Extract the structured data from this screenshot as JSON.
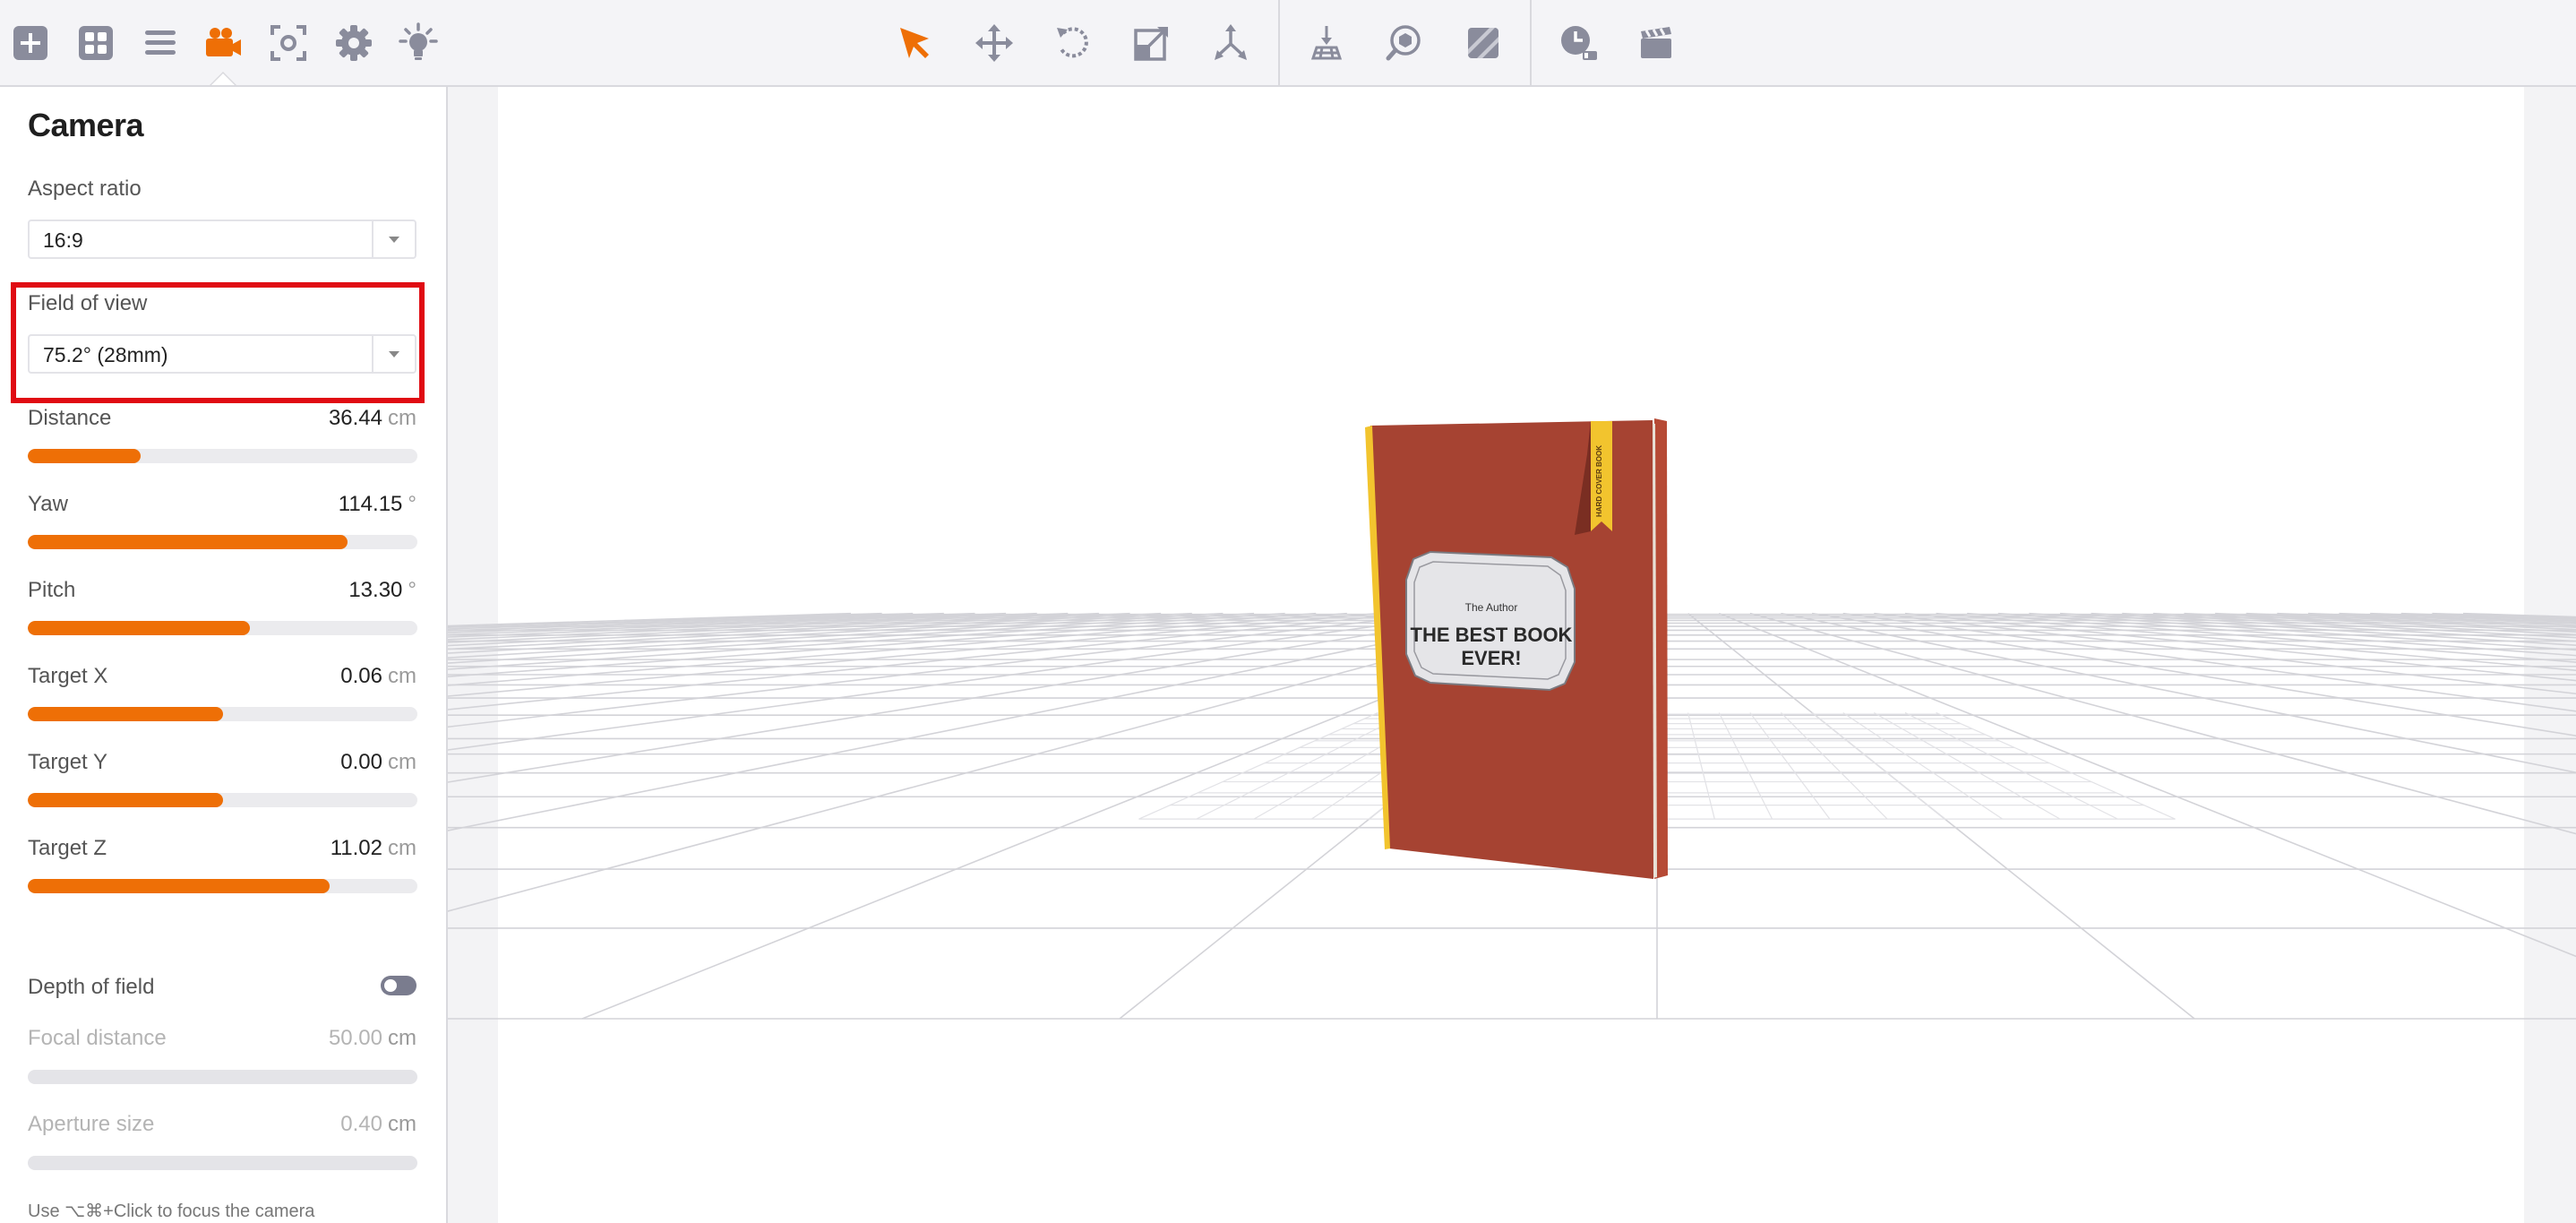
{
  "toolbar": {
    "left_icons": [
      "add-icon",
      "layout-icon",
      "list-icon",
      "camera-icon",
      "focus-icon",
      "gear-icon",
      "light-icon"
    ],
    "center_icons": [
      "select-arrow-icon",
      "move-icon",
      "rotate-icon",
      "scale-icon",
      "transform-icon"
    ],
    "right_icons": [
      "floor-icon",
      "view-cube-icon",
      "render-icon",
      "clock-icon",
      "clapperboard-icon"
    ],
    "active_tab": "camera-icon",
    "accent": "#ee6f06"
  },
  "camera_panel": {
    "title": "Camera",
    "aspect_ratio": {
      "label": "Aspect ratio",
      "value": "16:9"
    },
    "field_of_view": {
      "label": "Field of view",
      "value": "75.2° (28mm)"
    },
    "rows": [
      {
        "label": "Distance",
        "value": "36.44",
        "unit": "cm",
        "fill": 0.29
      },
      {
        "label": "Yaw",
        "value": "114.15",
        "unit": "°",
        "fill": 0.82
      },
      {
        "label": "Pitch",
        "value": "13.30",
        "unit": "°",
        "fill": 0.57
      },
      {
        "label": "Target X",
        "value": "0.06",
        "unit": "cm",
        "fill": 0.5
      },
      {
        "label": "Target Y",
        "value": "0.00",
        "unit": "cm",
        "fill": 0.5
      },
      {
        "label": "Target Z",
        "value": "11.02",
        "unit": "cm",
        "fill": 0.775
      }
    ],
    "depth_of_field": {
      "label": "Depth of field",
      "enabled": false
    },
    "disabled_rows": [
      {
        "label": "Focal distance",
        "value": "50.00",
        "unit": "cm"
      },
      {
        "label": "Aperture size",
        "value": "0.40",
        "unit": "cm"
      }
    ],
    "hint": "Use ⌥⌘+Click to focus the camera"
  },
  "scene": {
    "book": {
      "author": "The Author",
      "title_line1": "THE BEST BOOK",
      "title_line2": "EVER!",
      "bookmark_text": "HARD COVER BOOK",
      "cover_color": "#a64332",
      "bookmark_color": "#f2c42e"
    }
  }
}
